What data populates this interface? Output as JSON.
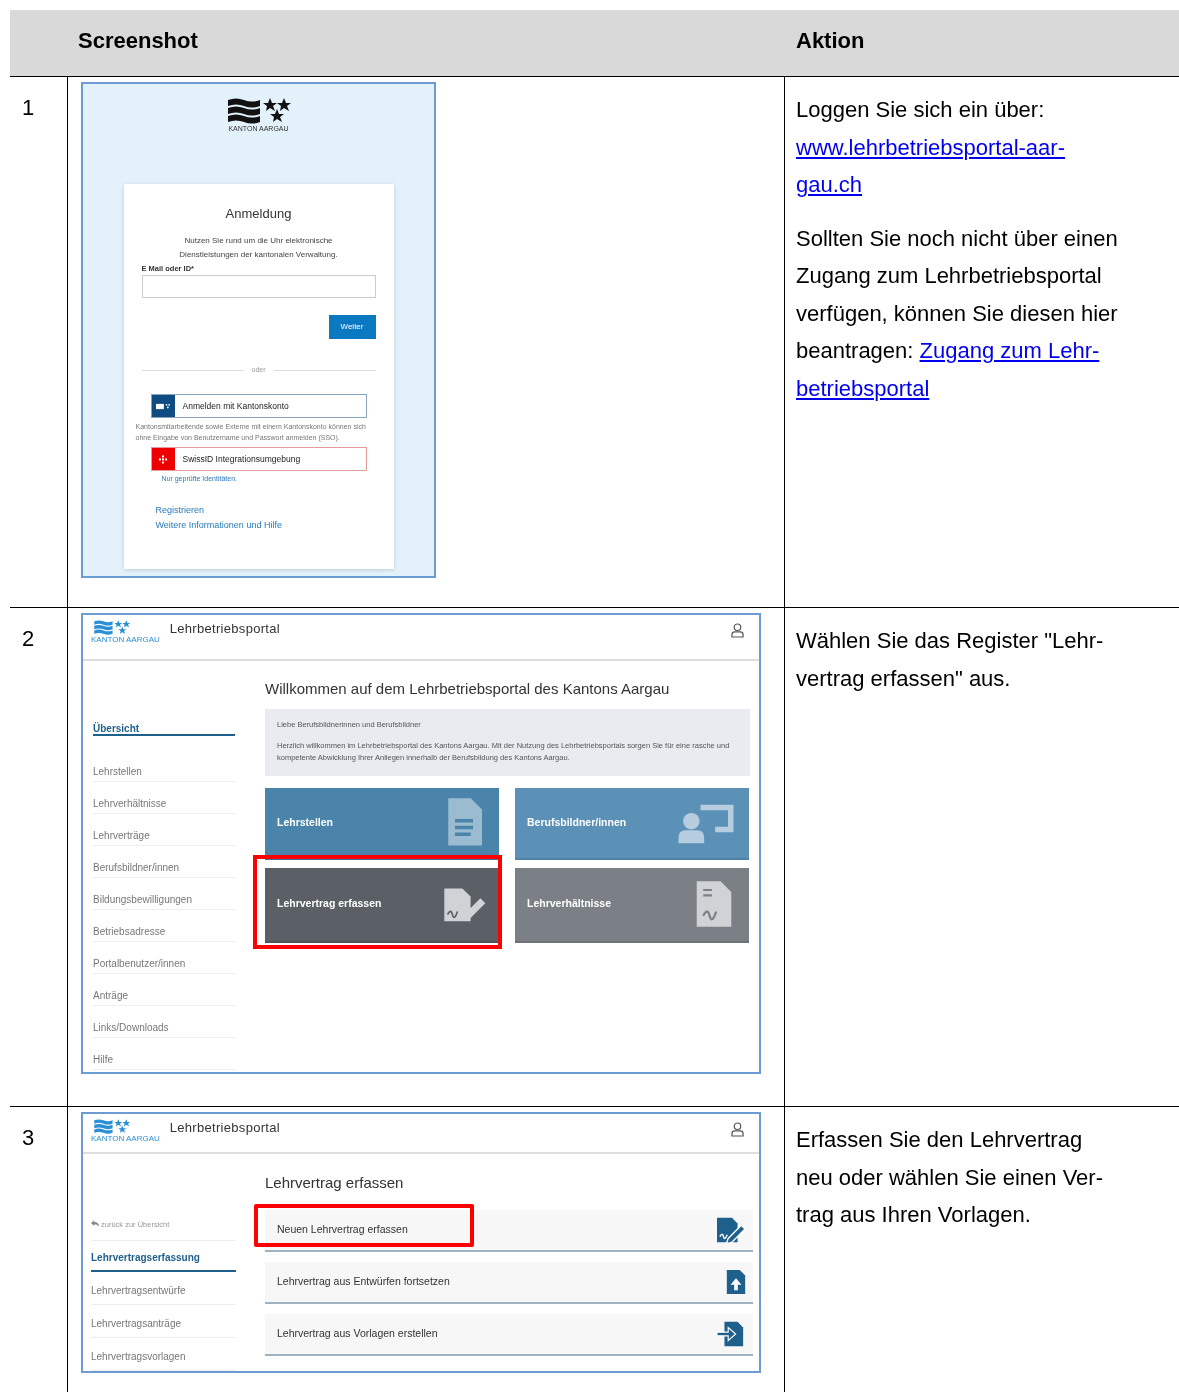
{
  "header": {
    "column_1": "Screenshot",
    "column_2": "Aktion"
  },
  "steps": [
    {
      "number": "1",
      "kind": "login",
      "screenshot": {
        "logo_caption": "KANTON AARGAU",
        "title": "Anmeldung",
        "intro": "Nutzen Sie rund um die Uhr elektronische Dienstleistungen der kantonalen Verwaltung.",
        "field_label": "E Mail oder ID*",
        "submit": "Weiter",
        "divider": "oder",
        "providers": [
          {
            "label": "Anmelden mit Kantonskonto",
            "color": "#0f4c81",
            "note": "Kantonsmitarbeitende sowie Externe mit einem Kantonskonto können sich ohne Eingabe von Benutzername und Passwort anmelden (SSO).",
            "note_link": false
          },
          {
            "label": "SwissID Integrationsumgebung",
            "color": "#ee0000",
            "note": "Nur geprüfte Identitäten.",
            "note_link": true
          }
        ],
        "links": [
          "Registrieren",
          "Weitere Informationen und Hilfe"
        ]
      },
      "action": {
        "paragraphs": [
          {
            "lines": [
              [
                {
                  "text": "Loggen Sie sich ein über:",
                  "link": false
                }
              ],
              [
                {
                  "text": "www.lehrbetriebsportal-aar-",
                  "link": true
                }
              ],
              [
                {
                  "text": "gau.ch",
                  "link": true
                }
              ]
            ]
          },
          {
            "lines": [
              [
                {
                  "text": "Sollten Sie noch nicht über einen",
                  "link": false
                }
              ],
              [
                {
                  "text": "Zugang zum Lehrbetriebsportal",
                  "link": false
                }
              ],
              [
                {
                  "text": "verfügen, können Sie diesen hier",
                  "link": false
                }
              ],
              [
                {
                  "text": "beantragen: ",
                  "link": false
                },
                {
                  "text": "Zugang zum Lehr-",
                  "link": true
                }
              ],
              [
                {
                  "text": "betriebsportal",
                  "link": true
                }
              ]
            ]
          }
        ]
      }
    },
    {
      "number": "2",
      "kind": "portal_home",
      "screenshot": {
        "app_title": "Lehrbetriebsportal",
        "logo_caption": "KANTON AARGAU",
        "sidebar": [
          {
            "label": "Übersicht",
            "selected": true
          },
          {
            "label": "Lehrstellen",
            "selected": false
          },
          {
            "label": "Lehrverhältnisse",
            "selected": false
          },
          {
            "label": "Lehrverträge",
            "selected": false
          },
          {
            "label": "Berufsbildner/innen",
            "selected": false
          },
          {
            "label": "Bildungsbewilligungen",
            "selected": false
          },
          {
            "label": "Betriebsadresse",
            "selected": false
          },
          {
            "label": "Portalbenutzer/innen",
            "selected": false
          },
          {
            "label": "Anträge",
            "selected": false
          },
          {
            "label": "Links/Downloads",
            "selected": false
          },
          {
            "label": "Hilfe",
            "selected": false
          }
        ],
        "heading": "Willkommen auf dem Lehrbetriebsportal des Kantons Aargau",
        "info": [
          "Liebe Berufsbildnerinnen und Berufsbildner",
          "Herzlich willkommen im Lehrbetriebsportal des Kantons Aargau. Mit der Nutzung des Lehrbetriebsportals sorgen Sie für eine rasche und kompetente Abwicklung Ihrer Anliegen innerhalb der Berufsbildung des Kantons Aargau."
        ],
        "tiles": [
          {
            "label": "Lehrstellen",
            "color": "#4a84ab",
            "highlighted": false
          },
          {
            "label": "Berufsbildner/innen",
            "color": "#5b91b7",
            "highlighted": false
          },
          {
            "label": "Lehrvertrag erfassen",
            "color": "#5b5f66",
            "highlighted": true
          },
          {
            "label": "Lehrverhältnisse",
            "color": "#7b8087",
            "highlighted": false
          }
        ]
      },
      "action": {
        "paragraphs": [
          {
            "lines": [
              [
                {
                  "text": "Wählen Sie das Register \"Lehr-",
                  "link": false
                }
              ],
              [
                {
                  "text": "vertrag erfassen\" aus.",
                  "link": false
                }
              ]
            ]
          }
        ]
      }
    },
    {
      "number": "3",
      "kind": "portal_form",
      "screenshot": {
        "app_title": "Lehrbetriebsportal",
        "logo_caption": "KANTON AARGAU",
        "back_link": "zurück zur Übersicht",
        "sidebar": [
          {
            "label": "Lehrvertragserfassung",
            "selected": true
          },
          {
            "label": "Lehrvertragsentwürfe",
            "selected": false
          },
          {
            "label": "Lehrvertragsanträge",
            "selected": false
          },
          {
            "label": "Lehrvertragsvorlagen",
            "selected": false
          }
        ],
        "heading": "Lehrvertrag erfassen",
        "options": [
          {
            "label": "Neuen Lehrvertrag erfassen",
            "highlighted": true
          },
          {
            "label": "Lehrvertrag aus Entwürfen fortsetzen",
            "highlighted": false
          },
          {
            "label": "Lehrvertrag aus Vorlagen erstellen",
            "highlighted": false
          }
        ]
      },
      "action": {
        "paragraphs": [
          {
            "lines": [
              [
                {
                  "text": "Erfassen Sie den Lehrvertrag",
                  "link": false
                }
              ],
              [
                {
                  "text": "neu oder wählen Sie einen Ver-",
                  "link": false
                }
              ],
              [
                {
                  "text": "trag aus Ihren Vorlagen.",
                  "link": false
                }
              ]
            ]
          }
        ]
      }
    }
  ]
}
